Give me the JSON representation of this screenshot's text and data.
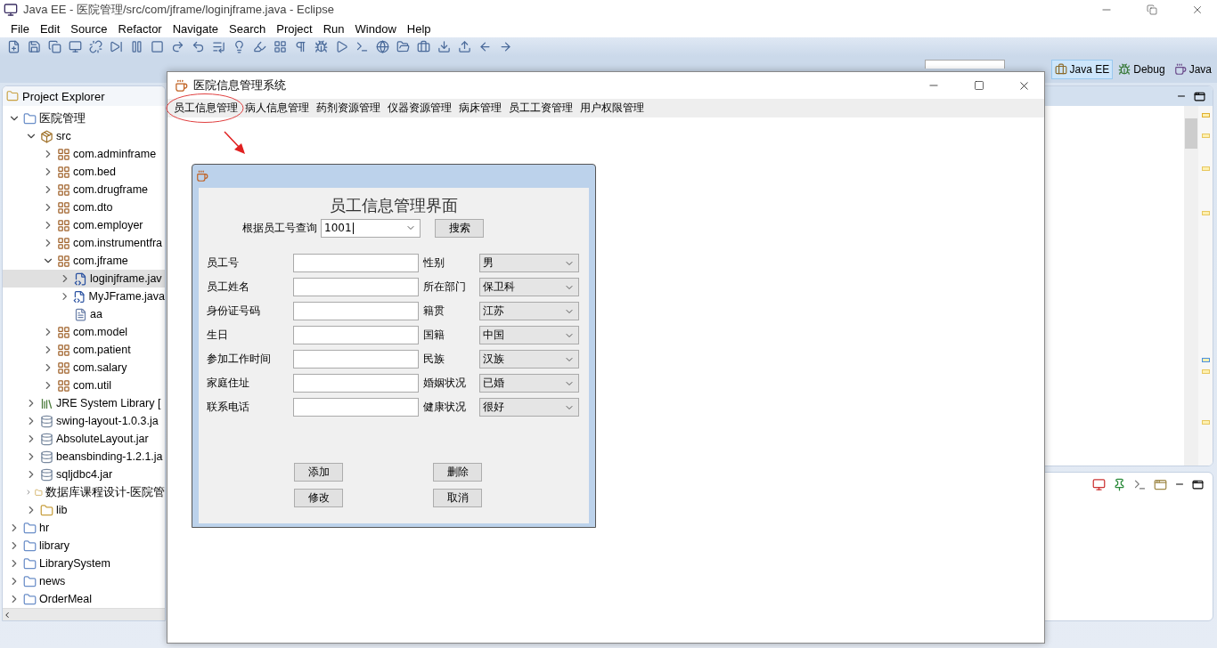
{
  "eclipse": {
    "title": "Java EE - 医院管理/src/com/jframe/loginjframe.java - Eclipse",
    "menu": [
      "File",
      "Edit",
      "Source",
      "Refactor",
      "Navigate",
      "Search",
      "Project",
      "Run",
      "Window",
      "Help"
    ],
    "perspectives": [
      {
        "label": "Java EE",
        "selected": true
      },
      {
        "label": "Debug",
        "selected": false
      },
      {
        "label": "Java",
        "selected": false
      }
    ]
  },
  "project_explorer": {
    "title": "Project Explorer",
    "tree": [
      {
        "label": "医院管理",
        "kind": "project",
        "expanded": true,
        "selected": false,
        "children": [
          {
            "label": "src",
            "kind": "source",
            "expanded": true,
            "selected": false,
            "children": [
              {
                "label": "com.adminframe",
                "kind": "package",
                "expanded": false,
                "selected": false
              },
              {
                "label": "com.bed",
                "kind": "package",
                "expanded": false,
                "selected": false
              },
              {
                "label": "com.drugframe",
                "kind": "package",
                "expanded": false,
                "selected": false
              },
              {
                "label": "com.dto",
                "kind": "package",
                "expanded": false,
                "selected": false
              },
              {
                "label": "com.employer",
                "kind": "package",
                "expanded": false,
                "selected": false
              },
              {
                "label": "com.instrumentfra",
                "kind": "package",
                "expanded": false,
                "selected": false
              },
              {
                "label": "com.jframe",
                "kind": "package",
                "expanded": true,
                "selected": false,
                "children": [
                  {
                    "label": "loginjframe.jav",
                    "kind": "java",
                    "expanded": false,
                    "selected": true
                  },
                  {
                    "label": "MyJFrame.java",
                    "kind": "java",
                    "expanded": false,
                    "selected": false
                  },
                  {
                    "label": "aa",
                    "kind": "file",
                    "selected": false
                  }
                ]
              },
              {
                "label": "com.model",
                "kind": "package",
                "expanded": false,
                "selected": false
              },
              {
                "label": "com.patient",
                "kind": "package",
                "expanded": false,
                "selected": false
              },
              {
                "label": "com.salary",
                "kind": "package",
                "expanded": false,
                "selected": false
              },
              {
                "label": "com.util",
                "kind": "package",
                "expanded": false,
                "selected": false
              }
            ]
          },
          {
            "label": "JRE System Library [",
            "kind": "library",
            "expanded": false,
            "selected": false
          },
          {
            "label": "swing-layout-1.0.3.ja",
            "kind": "jar",
            "expanded": false,
            "selected": false
          },
          {
            "label": "AbsoluteLayout.jar",
            "kind": "jar",
            "expanded": false,
            "selected": false
          },
          {
            "label": "beansbinding-1.2.1.ja",
            "kind": "jar",
            "expanded": false,
            "selected": false
          },
          {
            "label": "sqljdbc4.jar",
            "kind": "jar",
            "expanded": false,
            "selected": false
          },
          {
            "label": "数据库课程设计-医院管",
            "kind": "folder",
            "expanded": false,
            "selected": false
          },
          {
            "label": "lib",
            "kind": "folder",
            "expanded": false,
            "selected": false
          }
        ]
      },
      {
        "label": "hr",
        "kind": "project",
        "expanded": false,
        "selected": false
      },
      {
        "label": "library",
        "kind": "project",
        "expanded": false,
        "selected": false
      },
      {
        "label": "LibrarySystem",
        "kind": "project",
        "expanded": false,
        "selected": false
      },
      {
        "label": "news",
        "kind": "project",
        "expanded": false,
        "selected": false
      },
      {
        "label": "OrderMeal",
        "kind": "project",
        "expanded": false,
        "selected": false
      }
    ]
  },
  "app_window": {
    "title": "医院信息管理系统",
    "menu": [
      {
        "label": "员工信息管理",
        "circled": true
      },
      {
        "label": "病人信息管理",
        "circled": false
      },
      {
        "label": "药剂资源管理",
        "circled": false
      },
      {
        "label": "仪器资源管理",
        "circled": false
      },
      {
        "label": "病床管理",
        "circled": false
      },
      {
        "label": "员工工资管理",
        "circled": false
      },
      {
        "label": "用户权限管理",
        "circled": false
      }
    ]
  },
  "form_window": {
    "heading": "员工信息管理界面",
    "search_label": "根据员工号查询",
    "search_value": "1001",
    "search_button": "搜索",
    "rows": [
      {
        "field": "员工号",
        "select_label": "性别",
        "select_value": "男"
      },
      {
        "field": "员工姓名",
        "select_label": "所在部门",
        "select_value": "保卫科"
      },
      {
        "field": "身份证号码",
        "select_label": "籍贯",
        "select_value": "江苏"
      },
      {
        "field": "生日",
        "select_label": "国籍",
        "select_value": "中国"
      },
      {
        "field": "参加工作时间",
        "select_label": "民族",
        "select_value": "汉族"
      },
      {
        "field": "家庭住址",
        "select_label": "婚姻状况",
        "select_value": "已婚"
      },
      {
        "field": "联系电话",
        "select_label": "健康状况",
        "select_value": "很好"
      }
    ],
    "buttons": [
      "添加",
      "删除",
      "修改",
      "取消"
    ]
  }
}
